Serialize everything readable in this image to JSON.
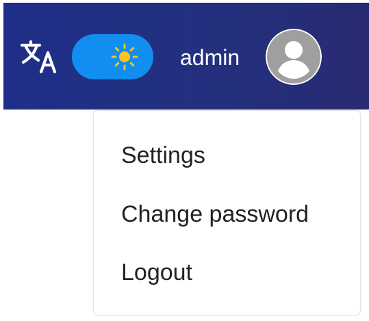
{
  "header": {
    "icons": {
      "translate": "translate-icon",
      "theme": "sun-icon",
      "avatar": "account-circle-icon"
    },
    "username": "admin"
  },
  "menu": {
    "items": [
      {
        "label": "Settings"
      },
      {
        "label": "Change password"
      },
      {
        "label": "Logout"
      }
    ]
  },
  "colors": {
    "header_start": "#1f2f88",
    "header_end": "#282a72",
    "toggle_blue": "#118ef0",
    "sun_yellow": "#ffc21f",
    "avatar_gray": "#9f9f9f",
    "menu_text": "#222222"
  }
}
